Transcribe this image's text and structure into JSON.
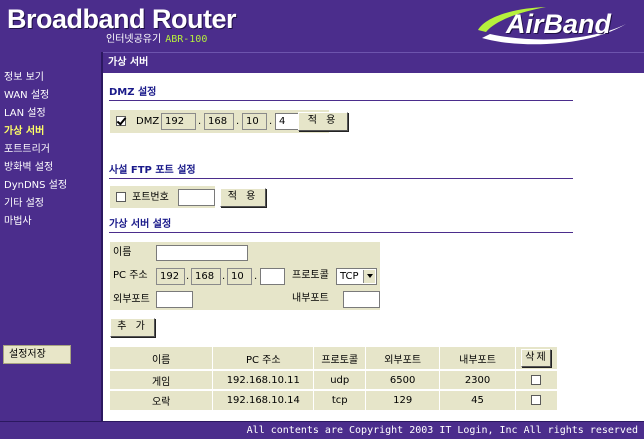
{
  "header": {
    "title": "Broadband Router",
    "subtitle": "인터넷공유기",
    "model": "ABR-100",
    "logo_text": "AirBand"
  },
  "sidebar": {
    "items": [
      {
        "label": "정보 보기"
      },
      {
        "label": "WAN 설정"
      },
      {
        "label": "LAN 설정"
      },
      {
        "label": "가상 서버",
        "active": true
      },
      {
        "label": "포트트리거"
      },
      {
        "label": "방화벽 설정"
      },
      {
        "label": "DynDNS 설정"
      },
      {
        "label": "기타 설정"
      },
      {
        "label": "마법사"
      }
    ],
    "save_label": "설정저장"
  },
  "page_title": "가상 서버",
  "dmz": {
    "section_title": "DMZ 설정",
    "checked": true,
    "label": "DMZ",
    "ip": [
      "192",
      "168",
      "10",
      "4"
    ],
    "apply_label": "적 용"
  },
  "ftp": {
    "section_title": "사설 FTP 포트 설정",
    "checked": false,
    "label": "포트번호",
    "port": "",
    "apply_label": "적 용"
  },
  "virtual_server": {
    "section_title": "가상 서버 설정",
    "name_label": "이름",
    "name_value": "",
    "pc_address_label": "PC 주소",
    "ip": [
      "192",
      "168",
      "10",
      ""
    ],
    "protocol_label": "프로토콜",
    "protocol_value": "TCP",
    "external_port_label": "외부포트",
    "external_port_value": "",
    "internal_port_label": "내부포트",
    "internal_port_value": "",
    "add_label": "추 가"
  },
  "table": {
    "columns": [
      "이름",
      "PC 주소",
      "프로토콜",
      "외부포트",
      "내부포트"
    ],
    "delete_label": "삭제",
    "rows": [
      {
        "name": "게임",
        "pc_address": "192.168.10.11",
        "protocol": "udp",
        "external_port": "6500",
        "internal_port": "2300"
      },
      {
        "name": "오락",
        "pc_address": "192.168.10.14",
        "protocol": "tcp",
        "external_port": "129",
        "internal_port": "45"
      }
    ]
  },
  "footer": "All contents are Copyright 2003 IT Login, Inc All rights reserved",
  "colors": {
    "frame": "#4b2d8c",
    "panel": "#e6e5c9",
    "model_text": "#b6f03c",
    "active_menu": "#ffff66"
  }
}
